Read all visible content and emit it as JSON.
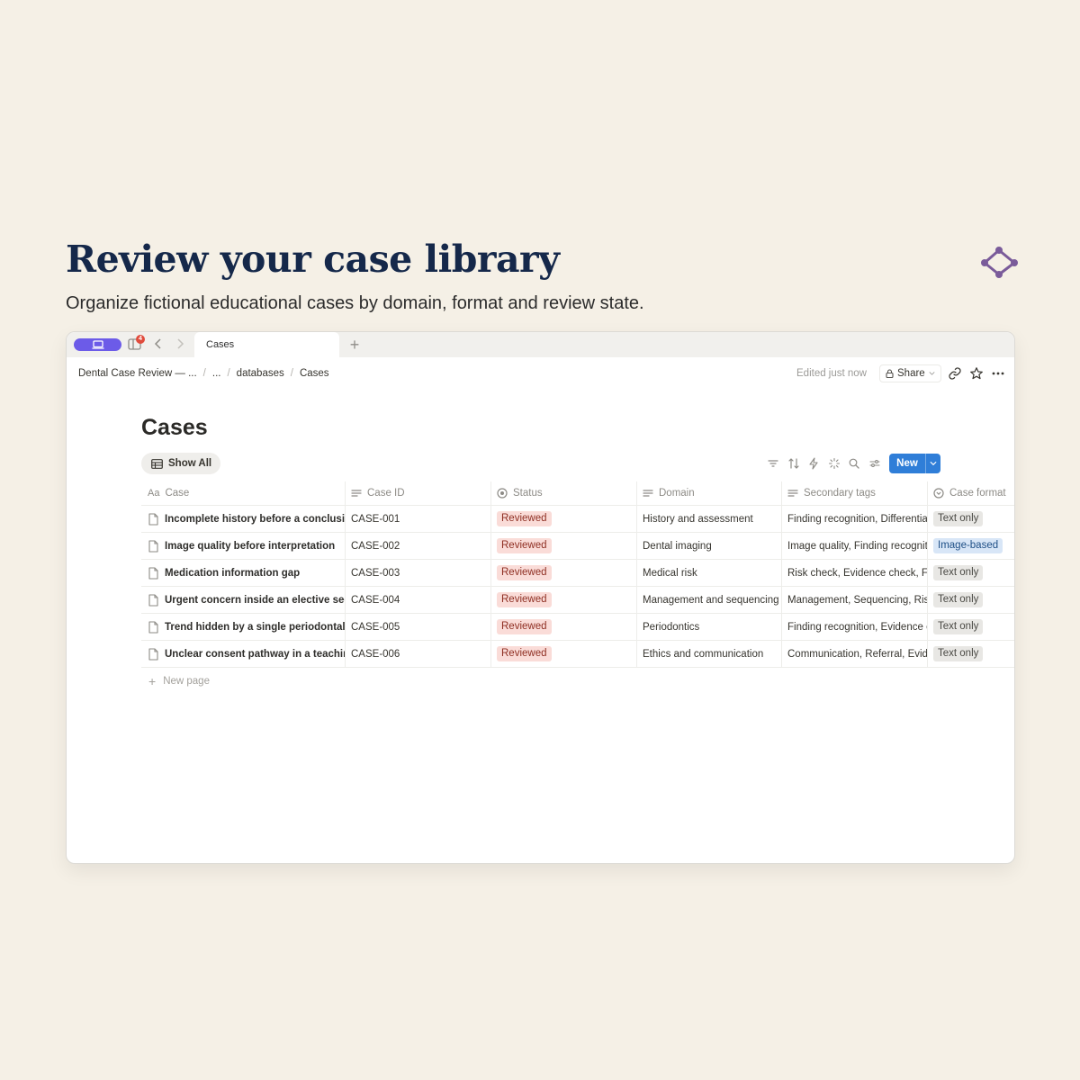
{
  "hero": {
    "title": "Review your case library",
    "subtitle": "Organize fictional educational cases by domain, format and review state.",
    "logo_icon": "node-graph-icon"
  },
  "window": {
    "tab_badge": "4",
    "active_tab": "Cases",
    "breadcrumbs": [
      "Dental Case Review — ...",
      "...",
      "databases",
      "Cases"
    ],
    "edited_text": "Edited just now",
    "share_label": "Share"
  },
  "page": {
    "title": "Cases",
    "view_label": "Show All",
    "new_button": "New",
    "new_page_label": "New page"
  },
  "table": {
    "columns": [
      {
        "label": "Case",
        "icon": "title-icon"
      },
      {
        "label": "Case ID",
        "icon": "text-lines-icon"
      },
      {
        "label": "Status",
        "icon": "status-icon"
      },
      {
        "label": "Domain",
        "icon": "text-lines-icon"
      },
      {
        "label": "Secondary tags",
        "icon": "text-lines-icon"
      },
      {
        "label": "Case format",
        "icon": "select-icon"
      }
    ],
    "rows": [
      {
        "case": "Incomplete history before a conclusion",
        "id": "CASE-001",
        "status": "Reviewed",
        "domain": "History and assessment",
        "tags": "Finding recognition, Differential",
        "format": "Text only"
      },
      {
        "case": "Image quality before interpretation",
        "id": "CASE-002",
        "status": "Reviewed",
        "domain": "Dental imaging",
        "tags": "Image quality, Finding recognition",
        "format": "Image-based"
      },
      {
        "case": "Medication information gap",
        "id": "CASE-003",
        "status": "Reviewed",
        "domain": "Medical risk",
        "tags": "Risk check, Evidence check, Follow-up",
        "format": "Text only"
      },
      {
        "case": "Urgent concern inside an elective sequence",
        "id": "CASE-004",
        "status": "Reviewed",
        "domain": "Management and sequencing",
        "tags": "Management, Sequencing, Risk check",
        "format": "Text only"
      },
      {
        "case": "Trend hidden by a single periodontal value",
        "id": "CASE-005",
        "status": "Reviewed",
        "domain": "Periodontics",
        "tags": "Finding recognition, Evidence check",
        "format": "Text only"
      },
      {
        "case": "Unclear consent pathway in a teaching case",
        "id": "CASE-006",
        "status": "Reviewed",
        "domain": "Ethics and communication",
        "tags": "Communication, Referral, Evidence check",
        "format": "Text only"
      }
    ]
  },
  "colors": {
    "background": "#f5f0e6",
    "title_navy": "#15284a",
    "accent_purple": "#6c5be8",
    "new_button_blue": "#2f7ed8",
    "reviewed_tag": "#fadcd8",
    "image_tag": "#d8e6f7"
  }
}
